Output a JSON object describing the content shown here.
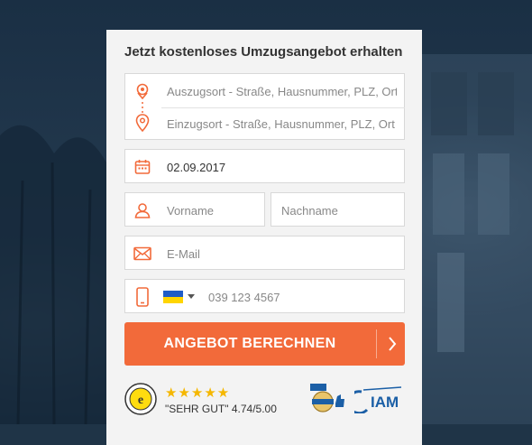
{
  "form": {
    "title": "Jetzt kostenloses Umzugsangebot erhalten",
    "from_placeholder": "Auszugsort - Straße, Hausnummer, PLZ, Ort",
    "to_placeholder": "Einzugsort - Straße, Hausnummer, PLZ, Ort",
    "date_value": "02.09.2017",
    "firstname_placeholder": "Vorname",
    "lastname_placeholder": "Nachname",
    "email_placeholder": "E-Mail",
    "phone_placeholder": "039 123 4567",
    "submit_label": "ANGEBOT BERECHNEN"
  },
  "trust": {
    "stars": "★★★★★",
    "rating_label": "\"SEHR GUT\" 4.74/5.00",
    "iam_label": "IAM"
  },
  "colors": {
    "accent": "#f26a3a",
    "star": "#f5b700",
    "iam_blue": "#1b5fa6"
  },
  "icons": [
    "location-pin-icon",
    "location-pin-icon",
    "calendar-icon",
    "user-icon",
    "envelope-icon",
    "mobile-phone-icon",
    "ukraine-flag-icon",
    "caret-down-icon",
    "chevron-right-icon",
    "trusted-shops-seal-icon",
    "kunden-badge-icon",
    "thumbs-up-icon",
    "iam-logo-icon"
  ]
}
